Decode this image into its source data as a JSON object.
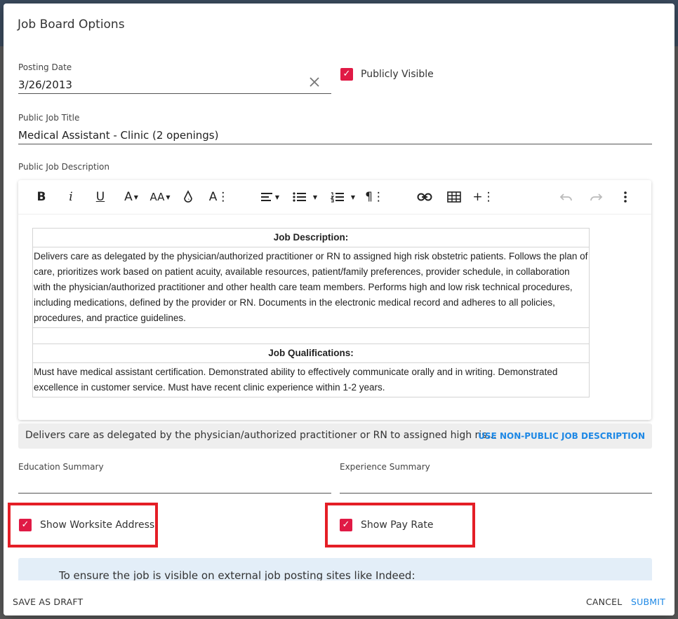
{
  "dialog": {
    "title": "Job Board Options"
  },
  "posting_date": {
    "label": "Posting Date",
    "value": "3/26/2013",
    "clear_icon": "close-icon"
  },
  "publicly_visible": {
    "label": "Publicly Visible",
    "checked": true
  },
  "job_title": {
    "label": "Public Job Title",
    "value": "Medical Assistant - Clinic (2 openings)"
  },
  "job_description": {
    "label": "Public Job Description",
    "toolbar": {
      "bold": "B",
      "italic": "i",
      "underline": "U",
      "font_color": "A",
      "font_size": "AA",
      "background_color": "paint-drop-icon",
      "text_style": "A⋮",
      "align": "align-left-icon",
      "bullet_list": "bullet-list-icon",
      "numbered_list": "numbered-list-icon",
      "paragraph": "¶⋮",
      "link": "link-icon",
      "table": "table-icon",
      "insert": "+⋮",
      "undo": "undo-icon",
      "redo": "redo-icon",
      "more": "more-vert-icon"
    },
    "content": {
      "heading1": "Job Description:",
      "body1": "Delivers care as delegated by the physician/authorized practitioner or RN to assigned high risk obstetric patients.  Follows the plan of care, prioritizes work based on patient  acuity, available resources, patient/family preferences, provider schedule, in collaboration with the physician/authorized practitioner and other health care team members.  Performs high and low risk technical procedures, including medications, defined by the provider or RN.  Documents in the electronic medical record and adheres to all policies, procedures, and practice guidelines.",
      "heading2": "Job Qualifications:",
      "body2": "Must have medical assistant certification.  Demonstrated ability to effectively communicate orally and in writing.  Demonstrated excellence in customer service.  Must have recent clinic experience within 1-2 years."
    }
  },
  "non_public": {
    "text": "Delivers care as delegated by the physician/authorized practitioner or RN to assigned high risk obstetric patients.",
    "button": "USE NON-PUBLIC JOB DESCRIPTION"
  },
  "education_summary": {
    "label": "Education Summary",
    "value": ""
  },
  "experience_summary": {
    "label": "Experience Summary",
    "value": ""
  },
  "show_worksite_address": {
    "label": "Show Worksite Address",
    "checked": true
  },
  "show_pay_rate": {
    "label": "Show Pay Rate",
    "checked": true
  },
  "info": {
    "text": "To ensure the job is visible on external job posting sites like Indeed:"
  },
  "footer": {
    "save_draft": "SAVE AS DRAFT",
    "cancel": "CANCEL",
    "submit": "SUBMIT"
  },
  "colors": {
    "accent": "#e01a45",
    "link": "#1e88e5",
    "highlight": "#e41e26"
  }
}
